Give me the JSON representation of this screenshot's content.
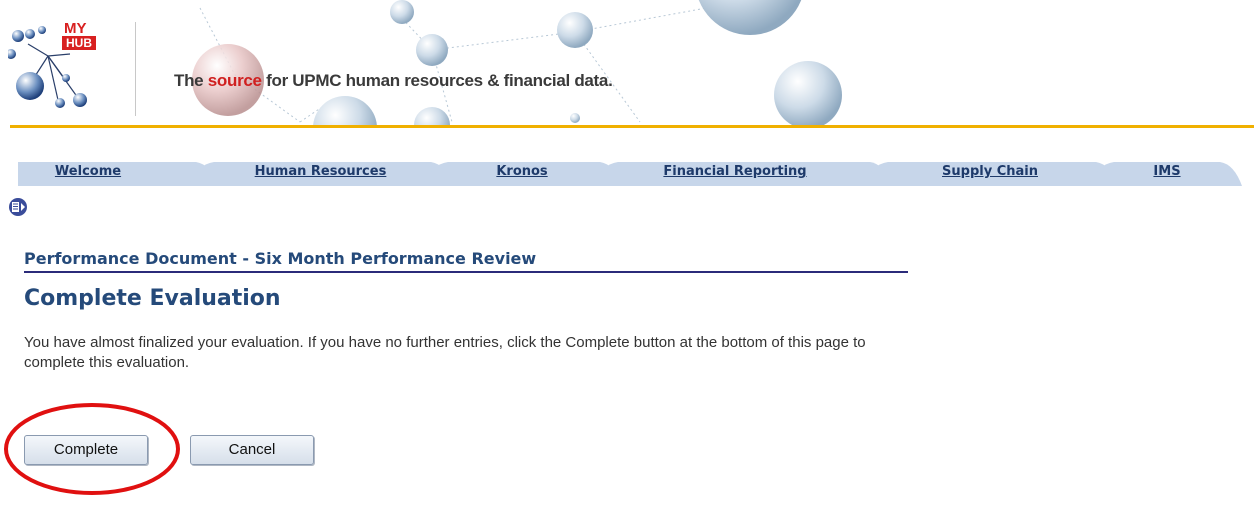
{
  "header": {
    "logo_my": "MY",
    "logo_hub": "HUB",
    "tagline_prefix": "The ",
    "tagline_highlight": "source",
    "tagline_suffix": " for UPMC human resources & financial data."
  },
  "tabs": [
    {
      "label": "Welcome"
    },
    {
      "label": "Human Resources"
    },
    {
      "label": "Kronos"
    },
    {
      "label": "Financial Reporting"
    },
    {
      "label": "Supply Chain"
    },
    {
      "label": "IMS"
    }
  ],
  "content": {
    "document_title": "Performance Document - Six Month Performance Review",
    "page_title": "Complete Evaluation",
    "instructions": "You have almost finalized your evaluation. If you have no further entries, click the Complete button at the bottom of this page to complete this evaluation."
  },
  "buttons": {
    "complete": "Complete",
    "cancel": "Cancel"
  },
  "colors": {
    "accent_gold": "#f0b000",
    "tab_blue": "#c7d6ea",
    "heading_blue": "#254a7a",
    "highlight_red": "#e01010"
  },
  "icons": {
    "nav": "menu-collapse-icon"
  }
}
